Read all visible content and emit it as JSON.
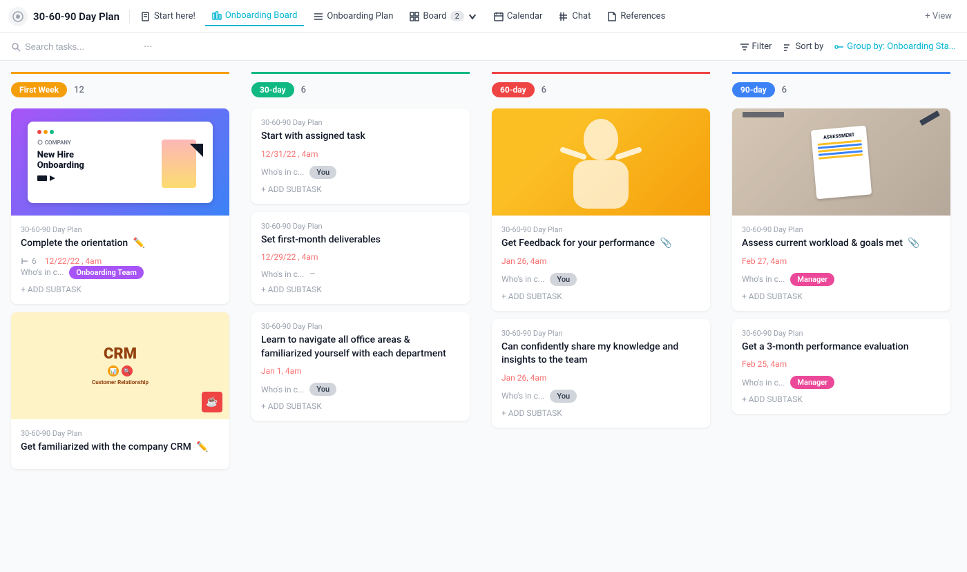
{
  "app": {
    "title": "30-60-90 Day Plan"
  },
  "nav": {
    "title": "30-60-90 Day Plan",
    "items": [
      {
        "id": "start-here",
        "label": "Start here!",
        "icon": "document-icon",
        "active": false
      },
      {
        "id": "onboarding-board",
        "label": "Onboarding Board",
        "icon": "board-icon",
        "active": true
      },
      {
        "id": "onboarding-plan",
        "label": "Onboarding Plan",
        "icon": "list-icon",
        "active": false
      },
      {
        "id": "board",
        "label": "Board",
        "icon": "grid-icon",
        "active": false,
        "badge": "2"
      },
      {
        "id": "calendar",
        "label": "Calendar",
        "icon": "calendar-icon",
        "active": false
      },
      {
        "id": "chat",
        "label": "Chat",
        "icon": "hash-icon",
        "active": false
      },
      {
        "id": "references",
        "label": "References",
        "icon": "doc-icon",
        "active": false
      }
    ],
    "add_view": "+ View"
  },
  "toolbar": {
    "search_placeholder": "Search tasks...",
    "filter_label": "Filter",
    "sort_label": "Sort by",
    "group_by_label": "Group by: Onboarding Sta..."
  },
  "columns": [
    {
      "id": "first-week",
      "label": "First Week",
      "badge_color": "#f59e0b",
      "border_color": "#f59e0b",
      "count": 12,
      "cards": [
        {
          "id": "card-1",
          "has_image": true,
          "image_type": "onboarding",
          "plan": "30-60-90 Day Plan",
          "title": "Complete the orientation",
          "has_clip": true,
          "attachment_count": "6",
          "date": "12/22/22 , 4am",
          "whos_in_c": "Who's in c...",
          "assignee": "Onboarding Team",
          "assignee_type": "team",
          "add_subtask": "+ ADD SUBTASK"
        },
        {
          "id": "card-2",
          "has_image": true,
          "image_type": "crm",
          "plan": "30-60-90 Day Plan",
          "title": "Get familiarized with the company CRM",
          "has_clip": true,
          "date": null,
          "whos_in_c": null,
          "assignee": null,
          "assignee_type": null,
          "add_subtask": null
        }
      ]
    },
    {
      "id": "30-day",
      "label": "30-day",
      "badge_color": "#10b981",
      "border_color": "#10b981",
      "count": 6,
      "cards": [
        {
          "id": "card-3",
          "has_image": false,
          "plan": "30-60-90 Day Plan",
          "title": "Start with assigned task",
          "has_clip": false,
          "date": "12/31/22 , 4am",
          "whos_in_c": "Who's in c...",
          "assignee": "You",
          "assignee_type": "you",
          "add_subtask": "+ ADD SUBTASK"
        },
        {
          "id": "card-4",
          "has_image": false,
          "plan": "30-60-90 Day Plan",
          "title": "Set first-month deliverables",
          "has_clip": false,
          "date": "12/29/22 , 4am",
          "whos_in_c": "Who's in c...",
          "assignee": "–",
          "assignee_type": "dash",
          "add_subtask": "+ ADD SUBTASK"
        },
        {
          "id": "card-5",
          "has_image": false,
          "plan": "30-60-90 Day Plan",
          "title": "Learn to navigate all office areas & familiarized yourself with each department",
          "has_clip": false,
          "date": "Jan 1, 4am",
          "whos_in_c": "Who's in c...",
          "assignee": "You",
          "assignee_type": "you",
          "add_subtask": "+ ADD SUBTASK"
        }
      ]
    },
    {
      "id": "60-day",
      "label": "60-day",
      "badge_color": "#ef4444",
      "border_color": "#ef4444",
      "count": 6,
      "cards": [
        {
          "id": "card-6",
          "has_image": true,
          "image_type": "person-yellow",
          "plan": "30-60-90 Day Plan",
          "title": "Get Feedback for your performance",
          "has_clip": true,
          "date": "Jan 26, 4am",
          "whos_in_c": "Who's in c...",
          "assignee": "You",
          "assignee_type": "you",
          "add_subtask": "+ ADD SUBTASK"
        },
        {
          "id": "card-7",
          "has_image": false,
          "plan": "30-60-90 Day Plan",
          "title": "Can confidently share my knowledge and insights to the team",
          "has_clip": false,
          "date": "Jan 26, 4am",
          "whos_in_c": "Who's in c...",
          "assignee": "You",
          "assignee_type": "you",
          "add_subtask": "+ ADD SUBTASK"
        }
      ]
    },
    {
      "id": "90-day",
      "label": "90-day",
      "badge_color": "#3b82f6",
      "border_color": "#3b82f6",
      "count": 6,
      "cards": [
        {
          "id": "card-8",
          "has_image": true,
          "image_type": "assessment",
          "plan": "30-60-90 Day Plan",
          "title": "Assess current workload & goals met",
          "has_clip": true,
          "date": "Feb 27, 4am",
          "whos_in_c": "Who's in c...",
          "assignee": "Manager",
          "assignee_type": "manager",
          "add_subtask": "+ ADD SUBTASK"
        },
        {
          "id": "card-9",
          "has_image": false,
          "plan": "30-60-90 Day Plan",
          "title": "Get a 3-month performance evaluation",
          "has_clip": false,
          "date": "Feb 25, 4am",
          "whos_in_c": "Who's in c...",
          "assignee": "Manager",
          "assignee_type": "manager",
          "add_subtask": "+ ADD SUBTASK"
        }
      ]
    }
  ]
}
